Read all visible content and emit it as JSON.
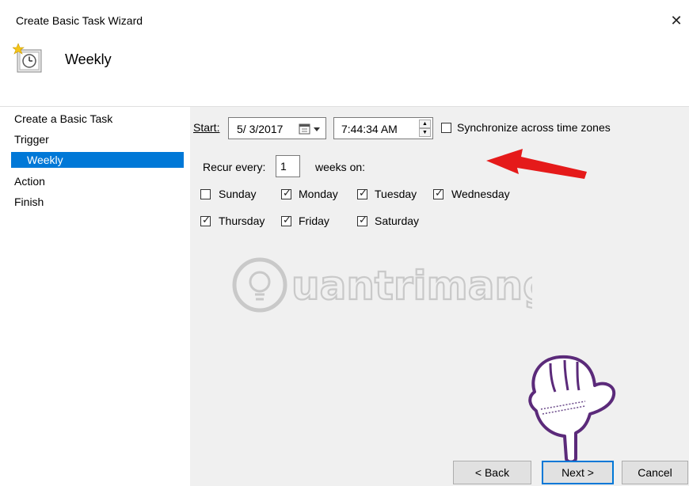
{
  "window": {
    "title": "Create Basic Task Wizard",
    "close_glyph": "✕"
  },
  "header": {
    "title": "Weekly",
    "icon": "scheduled-task-clock-icon"
  },
  "sidebar": {
    "items": [
      {
        "label": "Create a Basic Task",
        "selected": false
      },
      {
        "label": "Trigger",
        "selected": false
      },
      {
        "label": "Weekly",
        "selected": true
      },
      {
        "label": "Action",
        "selected": false
      },
      {
        "label": "Finish",
        "selected": false
      }
    ]
  },
  "trigger": {
    "start_label": "Start:",
    "date_value": "5/ 3/2017",
    "time_value": "7:44:34 AM",
    "sync_label": "Synchronize across time zones",
    "sync_checked": false,
    "recur_label": "Recur every:",
    "recur_value": "1",
    "weeks_on_label": "weeks on:",
    "days": {
      "sunday": {
        "label": "Sunday",
        "checked": false
      },
      "monday": {
        "label": "Monday",
        "checked": true
      },
      "tuesday": {
        "label": "Tuesday",
        "checked": true
      },
      "wednesday": {
        "label": "Wednesday",
        "checked": true
      },
      "thursday": {
        "label": "Thursday",
        "checked": true
      },
      "friday": {
        "label": "Friday",
        "checked": true
      },
      "saturday": {
        "label": "Saturday",
        "checked": true
      }
    }
  },
  "buttons": {
    "back": "< Back",
    "next": "Next >",
    "cancel": "Cancel"
  },
  "watermark": {
    "text": "uantrimang"
  },
  "colors": {
    "selection": "#0078d7",
    "arrow": "#e51a1a"
  }
}
